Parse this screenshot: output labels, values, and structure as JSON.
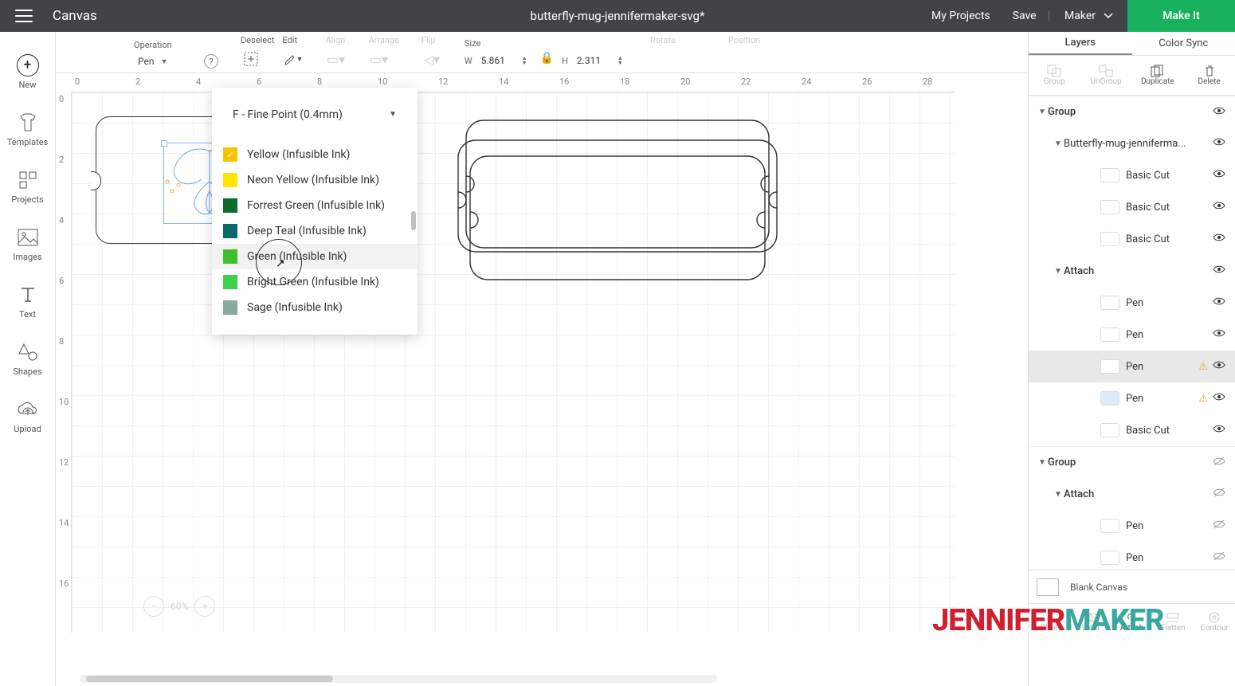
{
  "header": {
    "app_name": "Canvas",
    "document_title": "butterfly-mug-jennifermaker-svg*",
    "my_projects": "My Projects",
    "save": "Save",
    "machine": "Maker",
    "make_it": "Make It"
  },
  "propbar": {
    "operation_label": "Operation",
    "operation_value": "Pen",
    "deselect_label": "Deselect",
    "edit_label": "Edit",
    "align_label": "Align",
    "arrange_label": "Arrange",
    "flip_label": "Flip",
    "size_label": "Size",
    "w_label": "W",
    "w_value": "5.861",
    "h_label": "H",
    "h_value": "2.311",
    "rotate_label": "Rotate",
    "position_label": "Position"
  },
  "left_rail": {
    "new": "New",
    "templates": "Templates",
    "projects": "Projects",
    "images": "Images",
    "text": "Text",
    "shapes": "Shapes",
    "upload": "Upload"
  },
  "ruler_h": [
    "0",
    "2",
    "4",
    "6",
    "8",
    "10",
    "12",
    "14",
    "16",
    "18",
    "20",
    "22",
    "24",
    "26",
    "28"
  ],
  "ruler_v": [
    "0",
    "2",
    "4",
    "6",
    "8",
    "10",
    "12",
    "14",
    "16"
  ],
  "pen_popup": {
    "pen_type": "F - Fine Point (0.4mm)",
    "colors": [
      {
        "name": "Yellow (Infusible Ink)",
        "hex": "#f5c400",
        "checked": true
      },
      {
        "name": "Neon Yellow (Infusible Ink)",
        "hex": "#ffe600"
      },
      {
        "name": "Forrest Green (Infusible Ink)",
        "hex": "#0b6b2c"
      },
      {
        "name": "Deep Teal (Infusible Ink)",
        "hex": "#0a6a6a"
      },
      {
        "name": "Green (Infusible Ink)",
        "hex": "#3fbf2f",
        "hover": true
      },
      {
        "name": "Bright Green (Infusible Ink)",
        "hex": "#3dd24a"
      },
      {
        "name": "Sage (Infusible Ink)",
        "hex": "#8aa99a"
      }
    ]
  },
  "zoom_value": "60%",
  "right_panel": {
    "tab_layers": "Layers",
    "tab_color_sync": "Color Sync",
    "actions": {
      "group": "Group",
      "ungroup": "UnGroup",
      "duplicate": "Duplicate",
      "delete": "Delete"
    },
    "layers": [
      {
        "indent": 0,
        "chev": true,
        "label": "Group",
        "vis": "show",
        "header": true
      },
      {
        "indent": 1,
        "chev": true,
        "label": "Butterfly-mug-jenniferma...",
        "vis": "show"
      },
      {
        "indent": 3,
        "swatch": "#fff",
        "label": "Basic Cut",
        "vis": "show"
      },
      {
        "indent": 3,
        "swatch": "#fff",
        "label": "Basic Cut",
        "vis": "show"
      },
      {
        "indent": 3,
        "swatch": "#fff",
        "label": "Basic Cut",
        "vis": "show"
      },
      {
        "indent": 1,
        "chev": true,
        "label": "Attach",
        "vis": "show",
        "header": true
      },
      {
        "indent": 3,
        "swatch": "#fff",
        "label": "Pen",
        "vis": "show"
      },
      {
        "indent": 3,
        "swatch": "#fff",
        "label": "Pen",
        "vis": "show"
      },
      {
        "indent": 3,
        "swatch": "#fff",
        "label": "Pen",
        "vis": "show",
        "warn": true,
        "selected": true
      },
      {
        "indent": 3,
        "swatch": "#dcecf9",
        "label": "Pen",
        "vis": "show",
        "warn": true
      },
      {
        "indent": 3,
        "swatch": "#fff",
        "label": "Basic Cut",
        "vis": "show"
      },
      {
        "indent": 0,
        "chev": true,
        "label": "Group",
        "vis": "hide",
        "header": true
      },
      {
        "indent": 1,
        "chev": true,
        "label": "Attach",
        "vis": "hide",
        "header": true
      },
      {
        "indent": 3,
        "swatch": "#fff",
        "label": "Pen",
        "vis": "hide"
      },
      {
        "indent": 3,
        "swatch": "#fff",
        "label": "Pen",
        "vis": "hide"
      }
    ],
    "blank_canvas": "Blank Canvas",
    "bottom": {
      "slice": "Slice",
      "weld": "Weld",
      "attach": "Attach",
      "flatten": "Flatten",
      "contour": "Contour"
    }
  },
  "watermark": {
    "a": "JENNIFER",
    "b": "MAKER"
  }
}
